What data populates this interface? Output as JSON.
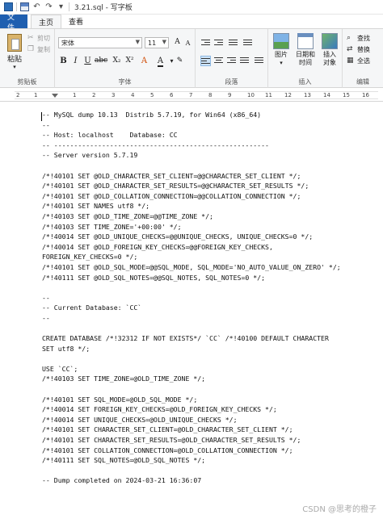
{
  "window": {
    "title": "3.21.sql - 写字板"
  },
  "tabs": {
    "file": "文件",
    "home": "主页",
    "view": "查看"
  },
  "clipboard": {
    "paste": "粘贴",
    "cut": "剪切",
    "copy": "复制",
    "label": "剪贴板"
  },
  "font": {
    "family": "宋体",
    "size": "11",
    "label": "字体"
  },
  "paragraph": {
    "label": "段落"
  },
  "insert": {
    "picture": "图片",
    "datetime_line1": "日期和",
    "datetime_line2": "时间",
    "object_line1": "插入",
    "object_line2": "对象",
    "label": "插入"
  },
  "editing": {
    "find": "查找",
    "replace": "替换",
    "select_all": "全选",
    "label": "编辑"
  },
  "ruler": {
    "numbers": [
      "2",
      "1",
      "1",
      "2",
      "3",
      "4",
      "5",
      "6",
      "7",
      "8",
      "9",
      "10",
      "11",
      "12",
      "13",
      "14",
      "15",
      "16"
    ]
  },
  "document": {
    "lines": [
      "-- MySQL dump 10.13  Distrib 5.7.19, for Win64 (x86_64)",
      "--",
      "-- Host: localhost    Database: CC",
      "-- ------------------------------------------------------",
      "-- Server version 5.7.19",
      "",
      "/*!40101 SET @OLD_CHARACTER_SET_CLIENT=@@CHARACTER_SET_CLIENT */;",
      "/*!40101 SET @OLD_CHARACTER_SET_RESULTS=@@CHARACTER_SET_RESULTS */;",
      "/*!40101 SET @OLD_COLLATION_CONNECTION=@@COLLATION_CONNECTION */;",
      "/*!40101 SET NAMES utf8 */;",
      "/*!40103 SET @OLD_TIME_ZONE=@@TIME_ZONE */;",
      "/*!40103 SET TIME_ZONE='+00:00' */;",
      "/*!40014 SET @OLD_UNIQUE_CHECKS=@@UNIQUE_CHECKS, UNIQUE_CHECKS=0 */;",
      "/*!40014 SET @OLD_FOREIGN_KEY_CHECKS=@@FOREIGN_KEY_CHECKS,",
      "FOREIGN_KEY_CHECKS=0 */;",
      "/*!40101 SET @OLD_SQL_MODE=@@SQL_MODE, SQL_MODE='NO_AUTO_VALUE_ON_ZERO' */;",
      "/*!40111 SET @OLD_SQL_NOTES=@@SQL_NOTES, SQL_NOTES=0 */;",
      "",
      "--",
      "-- Current Database: `CC`",
      "--",
      "",
      "CREATE DATABASE /*!32312 IF NOT EXISTS*/ `CC` /*!40100 DEFAULT CHARACTER",
      "SET utf8 */;",
      "",
      "USE `CC`;",
      "/*!40103 SET TIME_ZONE=@OLD_TIME_ZONE */;",
      "",
      "/*!40101 SET SQL_MODE=@OLD_SQL_MODE */;",
      "/*!40014 SET FOREIGN_KEY_CHECKS=@OLD_FOREIGN_KEY_CHECKS */;",
      "/*!40014 SET UNIQUE_CHECKS=@OLD_UNIQUE_CHECKS */;",
      "/*!40101 SET CHARACTER_SET_CLIENT=@OLD_CHARACTER_SET_CLIENT */;",
      "/*!40101 SET CHARACTER_SET_RESULTS=@OLD_CHARACTER_SET_RESULTS */;",
      "/*!40101 SET COLLATION_CONNECTION=@OLD_COLLATION_CONNECTION */;",
      "/*!40111 SET SQL_NOTES=@OLD_SQL_NOTES */;",
      "",
      "-- Dump completed on 2024-03-21 16:36:07"
    ]
  },
  "watermark": "CSDN @思考的橙子",
  "colors": {
    "file_tab": "#1f5fb0",
    "ribbon_bg": "#f5f6f7"
  }
}
